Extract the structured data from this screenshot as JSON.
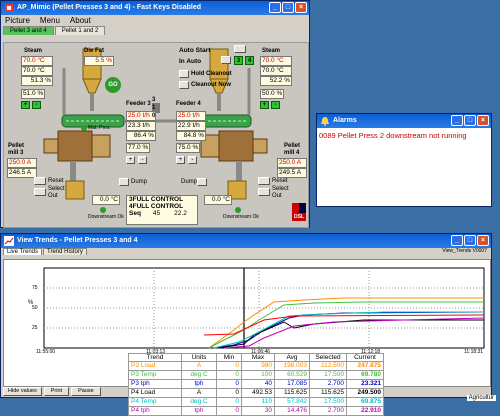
{
  "main_window": {
    "title": "AP_Mimic (Pellet Presses 3 and 4) - Fast Keys Disabled",
    "menu": [
      "Picture",
      "Menu",
      "About"
    ],
    "tabs": [
      "Pellet 3 and 4",
      "Pellet 1 and 2"
    ],
    "steam3": {
      "label": "Steam",
      "v1": "70.0 °C",
      "v2": "70.0 °C",
      "v3": "51.3 %",
      "v4": "51.0 %"
    },
    "steam4": {
      "label": "Steam",
      "v1": "70.0 °C",
      "v2": "70.0 °C",
      "v3": "52.2 %",
      "v4": "50.0 %"
    },
    "die_fat": {
      "label": "Die Fat",
      "value": "5.5 %"
    },
    "auto_start": "Auto Start",
    "in_auto": "In Auto",
    "auto_nums": [
      "3",
      "4"
    ],
    "hold_cleanout": "Hold Cleanout",
    "cleanout_now": "Cleanout Now",
    "feeder3": {
      "label": "Feeder 3",
      "v1": "25.0 t/h",
      "v2": "23.3 t/h",
      "v3": "86.4 %",
      "v4": "77.0 %"
    },
    "feeder4": {
      "label": "Feeder 4",
      "v1": "25.0 t/h",
      "v2": "22.9 t/h",
      "v3": "84.8 %",
      "v4": "75.0 %"
    },
    "feeder_num": [
      "3",
      "1",
      "0"
    ],
    "mat_pres": "Mat. Pres.",
    "mill3": {
      "label1": "Pellet",
      "label2": "mill 3",
      "v1": "250.0 A",
      "v2": "246.5 A"
    },
    "mill4": {
      "label1": "Pellet",
      "label2": "mill 4",
      "v1": "250.0 A",
      "v2": "249.5 A"
    },
    "dump": "Dump",
    "reset": "Reset",
    "select_out": [
      "Select",
      "Out"
    ],
    "temp3": "0.0 °C",
    "temp4": "0.0 °C",
    "downstream_ok": "Downstream Ok",
    "control_lines": [
      "3FULL CONTROL",
      "4FULL CONTROL"
    ],
    "seq_label": "Seq",
    "seq_values": [
      "45",
      "22.2"
    ],
    "go_label": "GO",
    "plus": "+",
    "minus": "-",
    "dsl_logo": "DSL"
  },
  "alarm_window": {
    "title": "Alarms",
    "message": "0089 Pellet Press 2 downstream not running"
  },
  "trends_window": {
    "title": "View Trends - Pellet Presses 3 and 4",
    "tabs": [
      "Live Trends",
      "Trend History"
    ],
    "toolbar_right": "View_Trends V0007",
    "y_label": "%",
    "y_ticks": [
      "75",
      "50",
      "25"
    ],
    "x_ticks": [
      "11:55:00",
      "11:03:13",
      "11:06:46",
      "11:12:18",
      "11:18:31"
    ],
    "headers": [
      "Trend",
      "Units",
      "Min",
      "Max",
      "Avg",
      "Selected",
      "Current"
    ],
    "rows": [
      {
        "trend": "P3 Load",
        "units": "A",
        "min": "0",
        "max": "980",
        "avg": "198.003",
        "selected": "112.500",
        "current": "247.875",
        "color": "#ff8c00"
      },
      {
        "trend": "P3 Temp",
        "units": "deg C",
        "min": "0",
        "max": "100",
        "avg": "60.529",
        "selected": "17.500",
        "current": "69.780",
        "color": "#40c040"
      },
      {
        "trend": "P3 tph",
        "units": "tph",
        "min": "0",
        "max": "40",
        "avg": "17.085",
        "selected": "2.700",
        "current": "23.321",
        "color": "#0000c0"
      },
      {
        "trend": "P4 Load",
        "units": "A",
        "min": "0",
        "max": "492.53",
        "avg": "115.625",
        "selected": "115.625",
        "current": "249.500",
        "color": "#000000"
      },
      {
        "trend": "P4 Temp",
        "units": "deg C",
        "min": "0",
        "max": "110",
        "avg": "57.842",
        "selected": "17.500",
        "current": "69.875",
        "color": "#00c0c0"
      },
      {
        "trend": "P4 tph",
        "units": "tph",
        "min": "0",
        "max": "30",
        "avg": "14.476",
        "selected": "2.700",
        "current": "22.910",
        "color": "#c000c0"
      }
    ],
    "footer_buttons": [
      "Hide values",
      "Print",
      "Pause"
    ]
  },
  "watermark": "Agricultur"
}
